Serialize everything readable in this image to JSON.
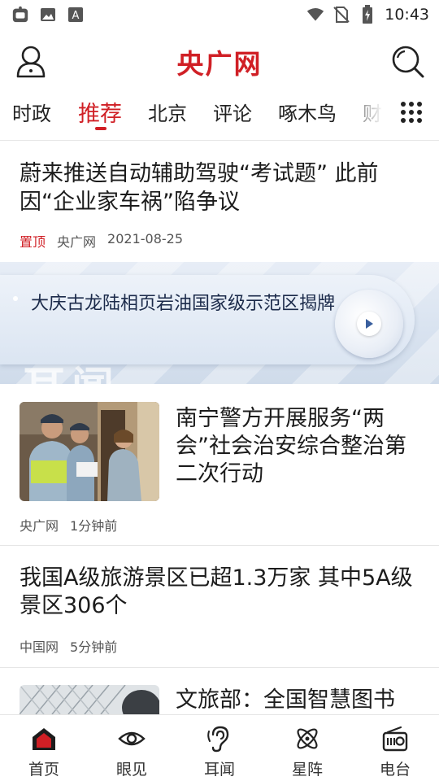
{
  "status_bar": {
    "time": "10:43",
    "icons": [
      "app-notification-icon",
      "image-icon",
      "font-icon",
      "wifi-icon",
      "no-sim-icon",
      "battery-charging-icon"
    ]
  },
  "header": {
    "logo": "央广网",
    "avatar_icon": "user-icon",
    "search_icon": "search-icon"
  },
  "tabs": {
    "items": [
      "时政",
      "推荐",
      "北京",
      "评论",
      "啄木鸟",
      "财经"
    ],
    "active": "推荐",
    "more_icon": "grid-icon"
  },
  "pinned": {
    "title": "蔚来推送自动辅助驾驶“考试题” 此前因“企业家车祸”陷争议",
    "tag": "置顶",
    "source": "央广网",
    "date": "2021-08-25"
  },
  "banner": {
    "title": "大庆古龙陆相页岩油国家级示范区揭牌",
    "watermark": "耳闻",
    "play_icon": "play-icon"
  },
  "news": [
    {
      "title": "南宁警方开展服务“两会”社会治安综合整治第二次行动",
      "source": "央广网",
      "time": "1分钟前"
    },
    {
      "title": "我国A级旅游景区已超1.3万家 其中5A级景区306个",
      "source": "中国网",
      "time": "5分钟前"
    },
    {
      "title": "文旅部：全国智慧图书"
    }
  ],
  "bottom_nav": [
    {
      "label": "首页",
      "icon": "home-icon",
      "active": true
    },
    {
      "label": "眼见",
      "icon": "eye-icon",
      "active": false
    },
    {
      "label": "耳闻",
      "icon": "ear-icon",
      "active": false
    },
    {
      "label": "星阵",
      "icon": "atom-icon",
      "active": false
    },
    {
      "label": "电台",
      "icon": "radio-icon",
      "active": false
    }
  ],
  "colors": {
    "brand_red": "#d01f25",
    "text": "#1c1c1c",
    "meta": "#555555"
  }
}
